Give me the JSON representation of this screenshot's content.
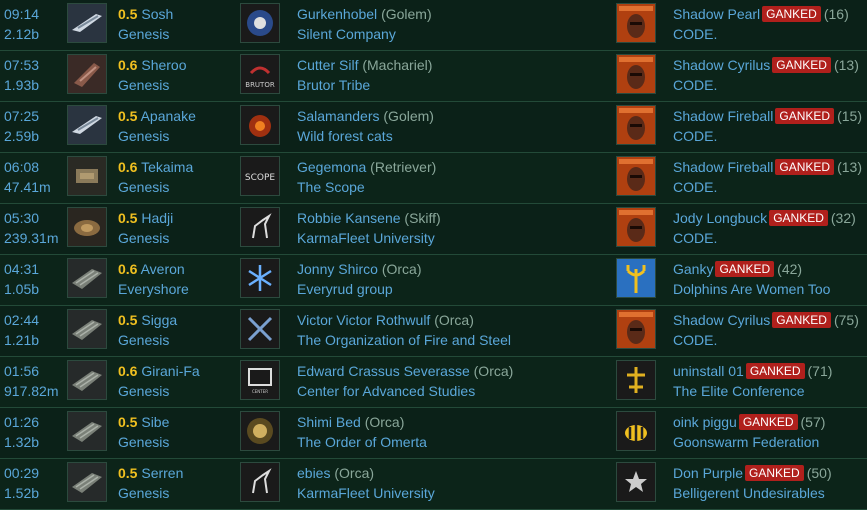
{
  "rows": [
    {
      "time": "09:14",
      "value": "2.12b",
      "sec": "0.5",
      "system": "Sosh",
      "region": "Genesis",
      "ship_icon": "golem-icon",
      "pilot": "Gurkenhobel",
      "ship": "(Golem)",
      "corp": "Silent Company",
      "corp_icon": "corp-logo-icon",
      "attacker": "Shadow Pearl",
      "badge": "GANKED",
      "count": "(16)",
      "attacker_corp": "CODE.",
      "attacker_icon": "code-portrait-icon"
    },
    {
      "time": "07:53",
      "value": "1.93b",
      "sec": "0.6",
      "system": "Sheroo",
      "region": "Genesis",
      "ship_icon": "machariel-icon",
      "pilot": "Cutter Silf",
      "ship": "(Machariel)",
      "corp": "Brutor Tribe",
      "corp_icon": "brutor-logo-icon",
      "attacker": "Shadow Cyrilus",
      "badge": "GANKED",
      "count": "(13)",
      "attacker_corp": "CODE.",
      "attacker_icon": "code-portrait-icon"
    },
    {
      "time": "07:25",
      "value": "2.59b",
      "sec": "0.5",
      "system": "Apanake",
      "region": "Genesis",
      "ship_icon": "golem-icon",
      "pilot": "Salamanders",
      "ship": "(Golem)",
      "corp": "Wild forest cats",
      "corp_icon": "fire-logo-icon",
      "attacker": "Shadow Fireball",
      "badge": "GANKED",
      "count": "(15)",
      "attacker_corp": "CODE.",
      "attacker_icon": "code-portrait-icon"
    },
    {
      "time": "06:08",
      "value": "47.41m",
      "sec": "0.6",
      "system": "Tekaima",
      "region": "Genesis",
      "ship_icon": "retriever-icon",
      "pilot": "Gegemona",
      "ship": "(Retriever)",
      "corp": "The Scope",
      "corp_icon": "scope-logo-icon",
      "attacker": "Shadow Fireball",
      "badge": "GANKED",
      "count": "(13)",
      "attacker_corp": "CODE.",
      "attacker_icon": "code-portrait-icon"
    },
    {
      "time": "05:30",
      "value": "239.31m",
      "sec": "0.5",
      "system": "Hadji",
      "region": "Genesis",
      "ship_icon": "skiff-icon",
      "pilot": "Robbie Kansene",
      "ship": "(Skiff)",
      "corp": "KarmaFleet University",
      "corp_icon": "unicorn-logo-icon",
      "attacker": "Jody Longbuck",
      "badge": "GANKED",
      "count": "(32)",
      "attacker_corp": "CODE.",
      "attacker_icon": "code-portrait-icon"
    },
    {
      "time": "04:31",
      "value": "1.05b",
      "sec": "0.6",
      "system": "Averon",
      "region": "Everyshore",
      "ship_icon": "orca-icon",
      "pilot": "Jonny Shirco",
      "ship": "(Orca)",
      "corp": "Everyrud group",
      "corp_icon": "snowflake-logo-icon",
      "attacker": "Ganky",
      "badge": "GANKED",
      "count": "(42)",
      "attacker_corp": "Dolphins Are Women Too",
      "attacker_icon": "trident-icon"
    },
    {
      "time": "02:44",
      "value": "1.21b",
      "sec": "0.5",
      "system": "Sigga",
      "region": "Genesis",
      "ship_icon": "orca-icon",
      "pilot": "Victor Victor Rothwulf",
      "ship": "(Orca)",
      "corp": "The Organization of Fire and Steel",
      "corp_icon": "crossed-swords-icon",
      "attacker": "Shadow Cyrilus",
      "badge": "GANKED",
      "count": "(75)",
      "attacker_corp": "CODE.",
      "attacker_icon": "code-portrait-icon"
    },
    {
      "time": "01:56",
      "value": "917.82m",
      "sec": "0.6",
      "system": "Girani-Fa",
      "region": "Genesis",
      "ship_icon": "orca-icon",
      "pilot": "Edward Crassus Severasse",
      "ship": "(Orca)",
      "corp": "Center for Advanced Studies",
      "corp_icon": "cas-logo-icon",
      "attacker": "uninstall 01",
      "badge": "GANKED",
      "count": "(71)",
      "attacker_corp": "The Elite Conference",
      "attacker_icon": "elite-logo-icon"
    },
    {
      "time": "01:26",
      "value": "1.32b",
      "sec": "0.5",
      "system": "Sibe",
      "region": "Genesis",
      "ship_icon": "orca-icon",
      "pilot": "Shimi Bed",
      "ship": "(Orca)",
      "corp": "The Order of Omerta",
      "corp_icon": "omerta-logo-icon",
      "attacker": "oink piggu",
      "badge": "GANKED",
      "count": "(57)",
      "attacker_corp": "Goonswarm Federation",
      "attacker_icon": "bee-logo-icon"
    },
    {
      "time": "00:29",
      "value": "1.52b",
      "sec": "0.5",
      "system": "Serren",
      "region": "Genesis",
      "ship_icon": "orca-icon",
      "pilot": "ebies",
      "ship": "(Orca)",
      "corp": "KarmaFleet University",
      "corp_icon": "unicorn-logo-icon",
      "attacker": "Don Purple",
      "badge": "GANKED",
      "count": "(50)",
      "attacker_corp": "Belligerent Undesirables",
      "attacker_icon": "star-logo-icon"
    }
  ],
  "colors": {
    "link": "#5aa7d9",
    "sec_high": "#f0c020",
    "ganked": "#b0201c",
    "muted": "#8aa79a"
  }
}
